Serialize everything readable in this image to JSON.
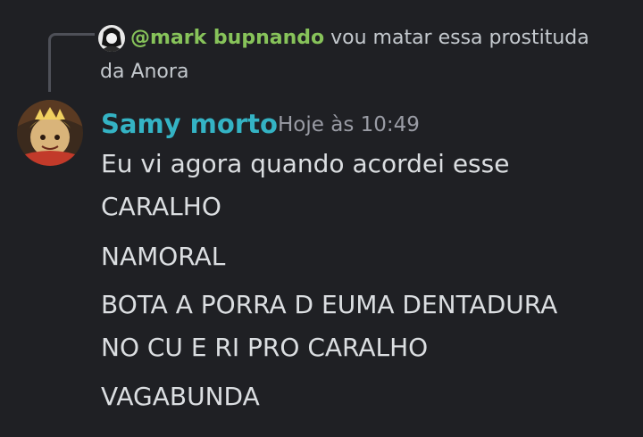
{
  "reply": {
    "mention": "@mark bupnando",
    "text_line1": "vou matar essa prostituda",
    "text_line2": "da Anora"
  },
  "message": {
    "author": "Samy morto",
    "timestamp": "Hoje às 10:49",
    "lines": [
      "Eu vi agora quando acordei esse",
      "CARALHO",
      "NAMORAL",
      "BOTA A PORRA D EUMA DENTADURA",
      "NO CU E RI PRO CARALHO",
      "VAGABUNDA"
    ]
  },
  "colors": {
    "background": "#1f2024",
    "author": "#34b3c4",
    "mention": "#87c35a",
    "timestamp": "#9a9ca5",
    "text": "#dbdee1"
  }
}
